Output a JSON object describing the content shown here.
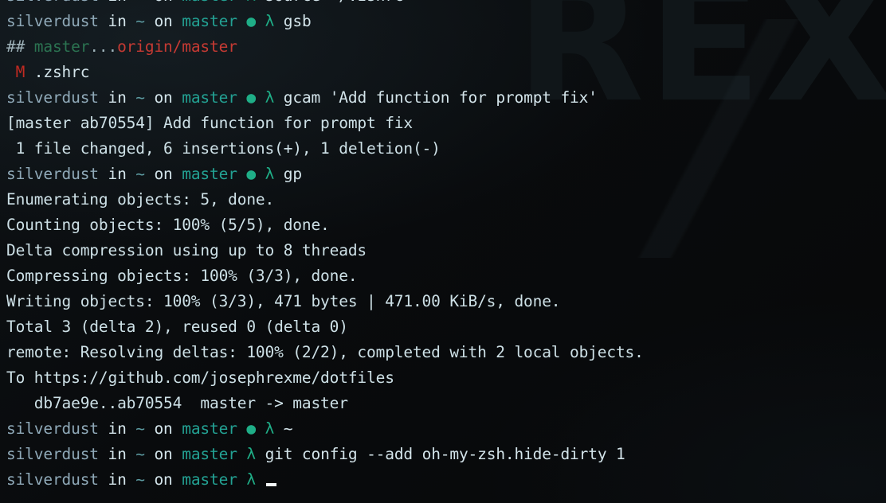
{
  "terminal": {
    "app": "zsh-terminal",
    "background_color": "#0a0c0e",
    "watermark_text": "REX",
    "prompt": {
      "user": "silverdust",
      "in": "in",
      "path": "~",
      "on": "on",
      "branch": "master",
      "dirty_marker": "●",
      "symbol": "λ"
    },
    "colors": {
      "user": "#8fa9b8",
      "plain": "#d3e4ea",
      "path": "#5c9aa0",
      "branch": "#23a193",
      "dirty_dot": "#1fae87",
      "lambda": "#1fae87",
      "git_green": "#2b7351",
      "git_red": "#c63a33",
      "modified_flag": "#c02a22",
      "output": "#cde0e6",
      "cursor": "#f2f7f8"
    },
    "lines": [
      {
        "id": "line-0-prompt-source",
        "type": "prompt",
        "clipped_top": true,
        "dirty": false,
        "command": "source ~/.zshrc"
      },
      {
        "id": "line-1-prompt-gsb",
        "type": "prompt",
        "dirty": true,
        "command": "gsb"
      },
      {
        "id": "line-2-git-branch-status",
        "type": "git-branch-status",
        "hash": "##",
        "local_branch": "master",
        "separator": "...",
        "remote_branch": "origin/master"
      },
      {
        "id": "line-3-git-modified-file",
        "type": "git-modified",
        "flag": "M",
        "file": ".zshrc"
      },
      {
        "id": "line-4-prompt-gcam",
        "type": "prompt",
        "dirty": true,
        "command": "gcam 'Add function for prompt fix'"
      },
      {
        "id": "line-5-commit-result",
        "type": "output",
        "text": "[master ab70554] Add function for prompt fix"
      },
      {
        "id": "line-6-commit-stats",
        "type": "output",
        "text": " 1 file changed, 6 insertions(+), 1 deletion(-)"
      },
      {
        "id": "line-7-prompt-gp",
        "type": "prompt",
        "dirty": true,
        "command": "gp"
      },
      {
        "id": "line-8-enumerating",
        "type": "output",
        "text": "Enumerating objects: 5, done."
      },
      {
        "id": "line-9-counting",
        "type": "output",
        "text": "Counting objects: 100% (5/5), done."
      },
      {
        "id": "line-10-delta-compression",
        "type": "output",
        "text": "Delta compression using up to 8 threads"
      },
      {
        "id": "line-11-compressing",
        "type": "output",
        "text": "Compressing objects: 100% (3/3), done."
      },
      {
        "id": "line-12-writing",
        "type": "output",
        "text": "Writing objects: 100% (3/3), 471 bytes | 471.00 KiB/s, done."
      },
      {
        "id": "line-13-total",
        "type": "output",
        "text": "Total 3 (delta 2), reused 0 (delta 0)"
      },
      {
        "id": "line-14-remote-resolving",
        "type": "output",
        "text": "remote: Resolving deltas: 100% (2/2), completed with 2 local objects."
      },
      {
        "id": "line-15-to-remote",
        "type": "output",
        "text": "To https://github.com/josephrexme/dotfiles"
      },
      {
        "id": "line-16-refspec",
        "type": "output",
        "text": "   db7ae9e..ab70554  master -> master"
      },
      {
        "id": "line-17-prompt-tilde",
        "type": "prompt",
        "dirty": true,
        "command": "~"
      },
      {
        "id": "line-18-prompt-gitconfig",
        "type": "prompt",
        "dirty": false,
        "command": "git config --add oh-my-zsh.hide-dirty 1"
      },
      {
        "id": "line-19-prompt-active",
        "type": "prompt",
        "dirty": false,
        "command": "",
        "cursor": true
      }
    ]
  }
}
